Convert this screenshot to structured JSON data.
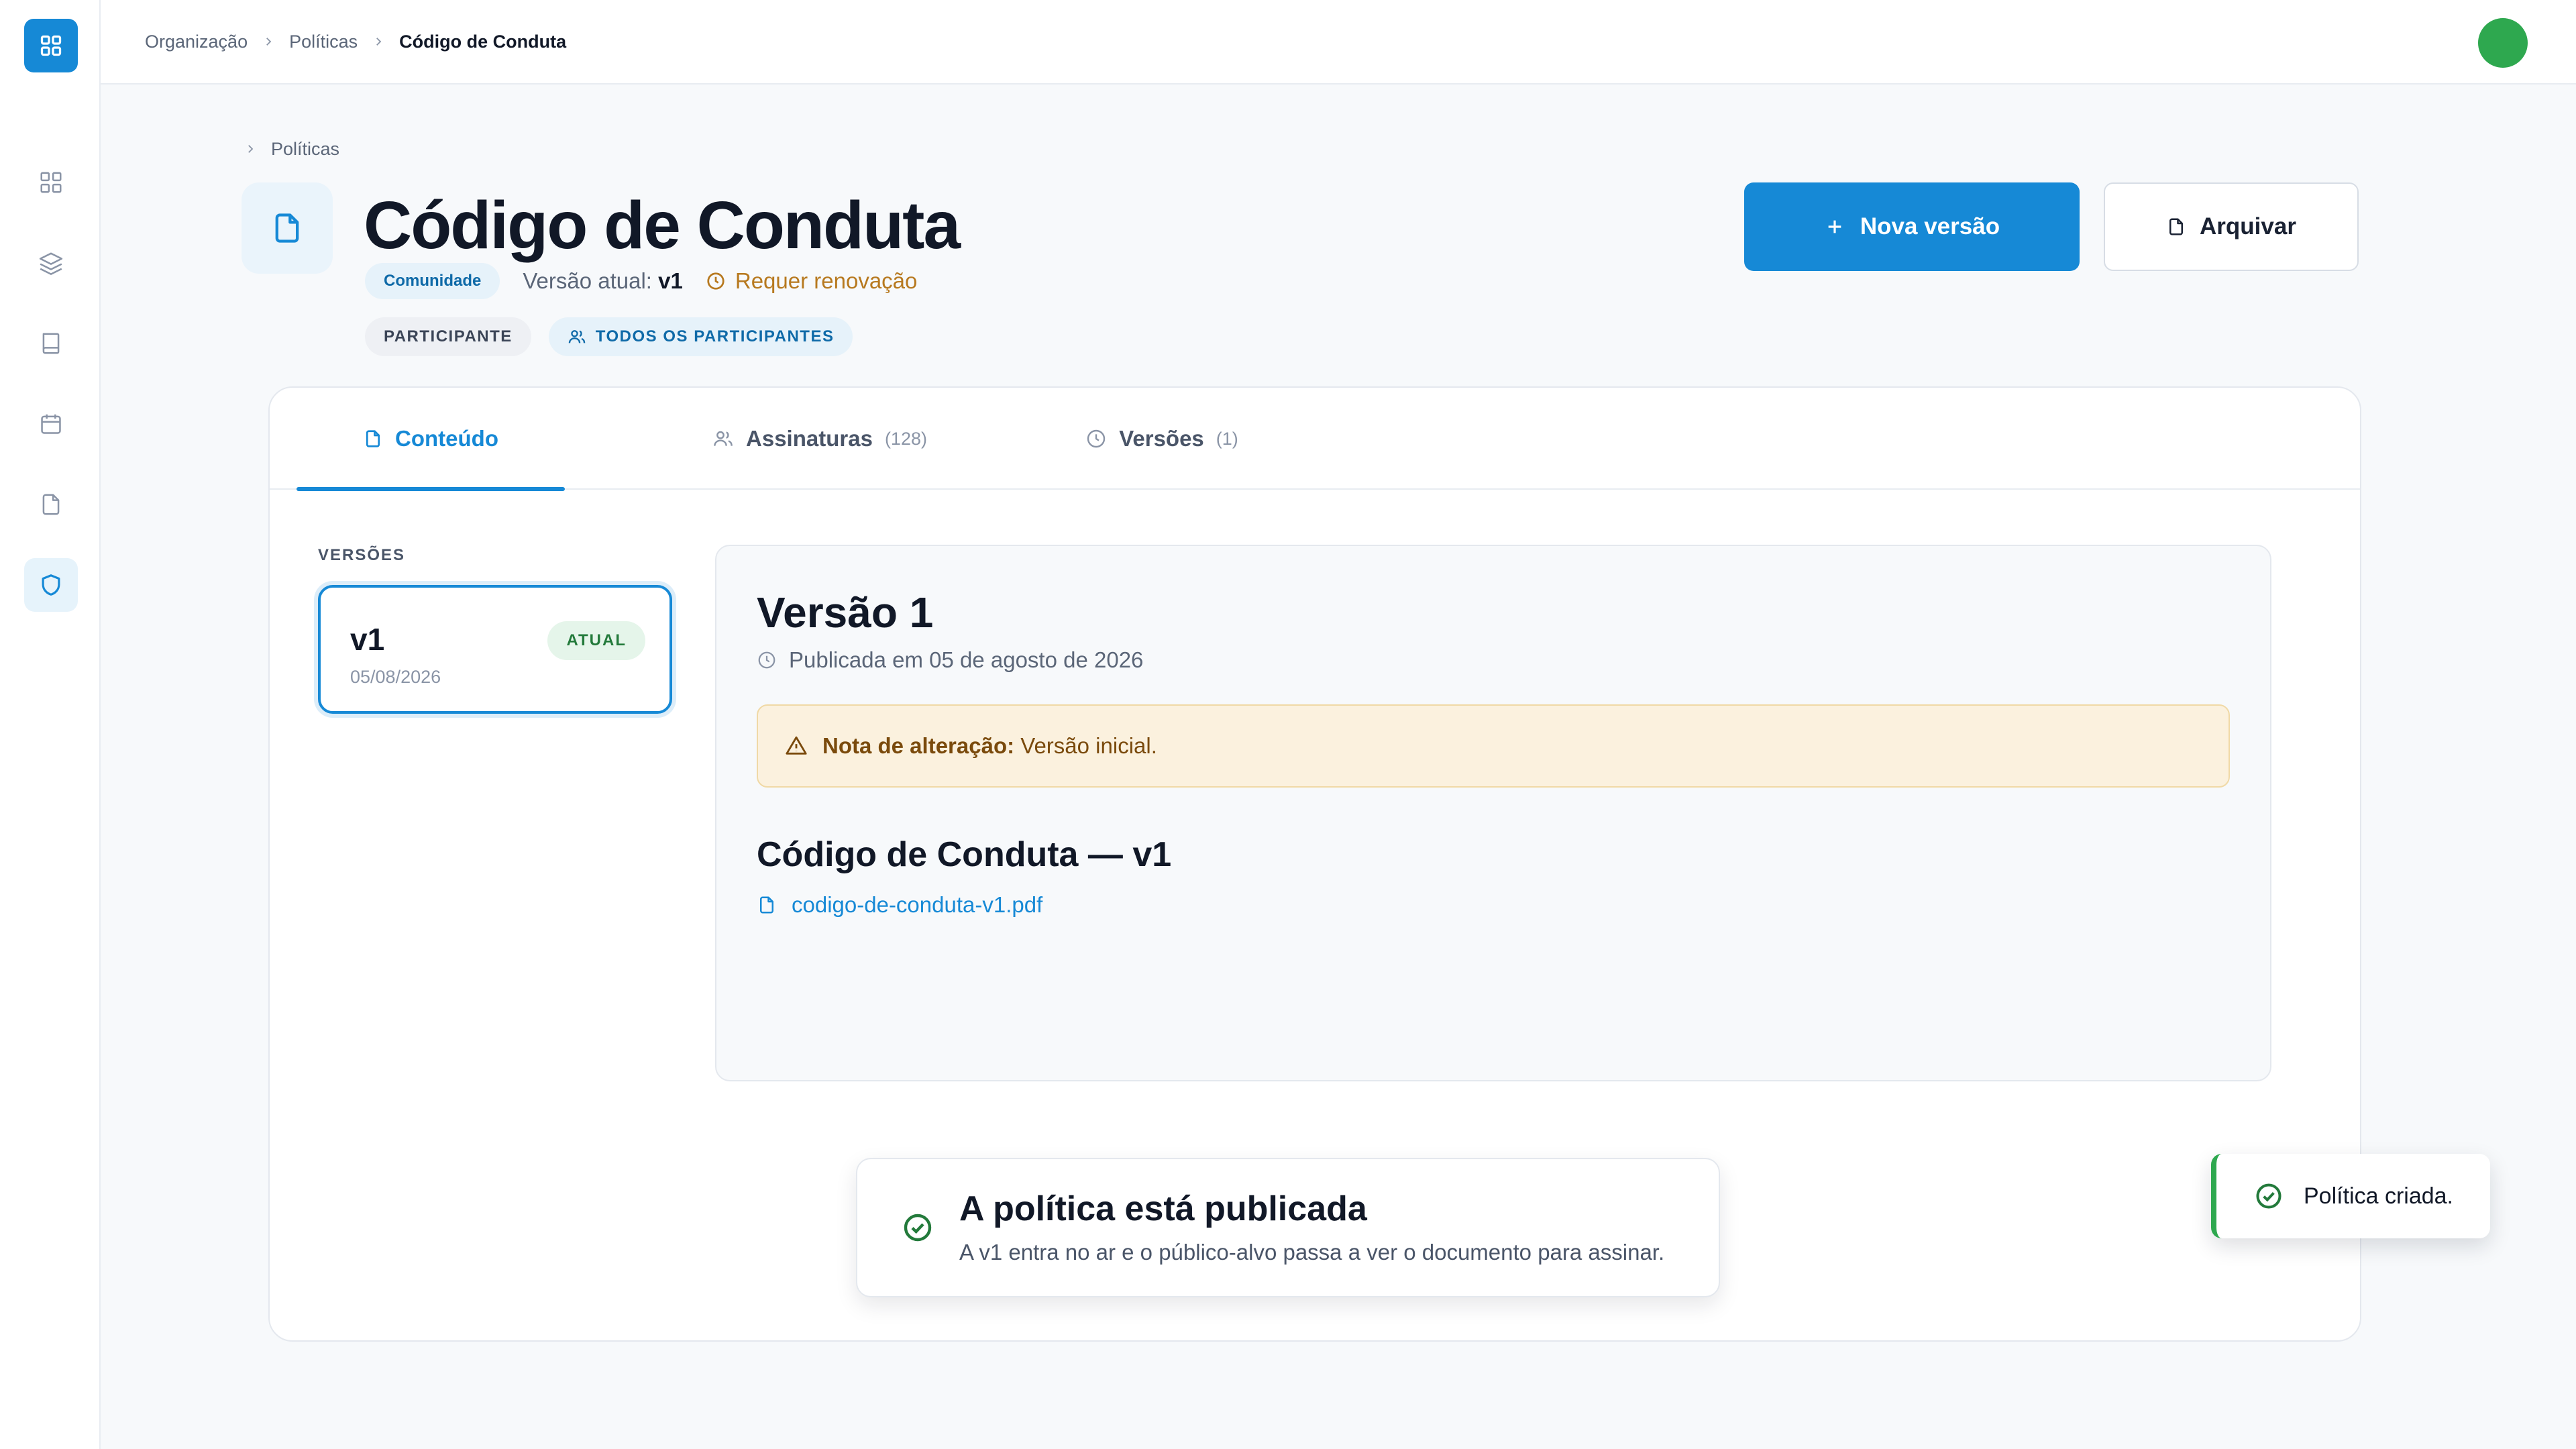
{
  "colors": {
    "brand": "#1689d6",
    "success": "#2ea84f",
    "warning": "#b7791f",
    "note_bg": "#fbf1de"
  },
  "sidebar": {
    "items": [
      {
        "icon": "grid-icon"
      },
      {
        "icon": "layers-icon"
      },
      {
        "icon": "book-icon"
      },
      {
        "icon": "calendar-icon"
      },
      {
        "icon": "file-icon"
      },
      {
        "icon": "shield-icon",
        "active": true
      }
    ]
  },
  "topbar": {
    "breadcrumb": [
      "Organização",
      "Políticas",
      "Código de Conduta"
    ]
  },
  "header": {
    "back_crumb": "Políticas",
    "title": "Código de Conduta",
    "community_label": "Comunidade",
    "version_prefix": "Versão atual:",
    "version_value": "v1",
    "renewal": "Requer renovação",
    "chip_role": "PARTICIPANTE",
    "chip_audience": "TODOS OS PARTICIPANTES",
    "new_version_button": "Nova versão",
    "archive_button": "Arquivar"
  },
  "tabs": [
    {
      "label": "Conteúdo",
      "count": "",
      "active": true
    },
    {
      "label": "Assinaturas",
      "count": "(128)"
    },
    {
      "label": "Versões",
      "count": "(1)"
    }
  ],
  "versions": {
    "label": "VERSÕES",
    "items": [
      {
        "name": "v1",
        "date": "05/08/2026",
        "badge": "ATUAL"
      }
    ]
  },
  "content": {
    "title": "Versão 1",
    "published": "Publicada em 05 de agosto de 2026",
    "note_label": "Nota de alteração:",
    "note_text": "Versão inicial.",
    "document_title": "Código de Conduta — v1",
    "file_name": "codigo-de-conduta-v1.pdf"
  },
  "banner": {
    "title": "A política está publicada",
    "text": "A v1 entra no ar e o público-alvo passa a ver o documento para assinar."
  },
  "toast": {
    "text": "Política criada."
  }
}
